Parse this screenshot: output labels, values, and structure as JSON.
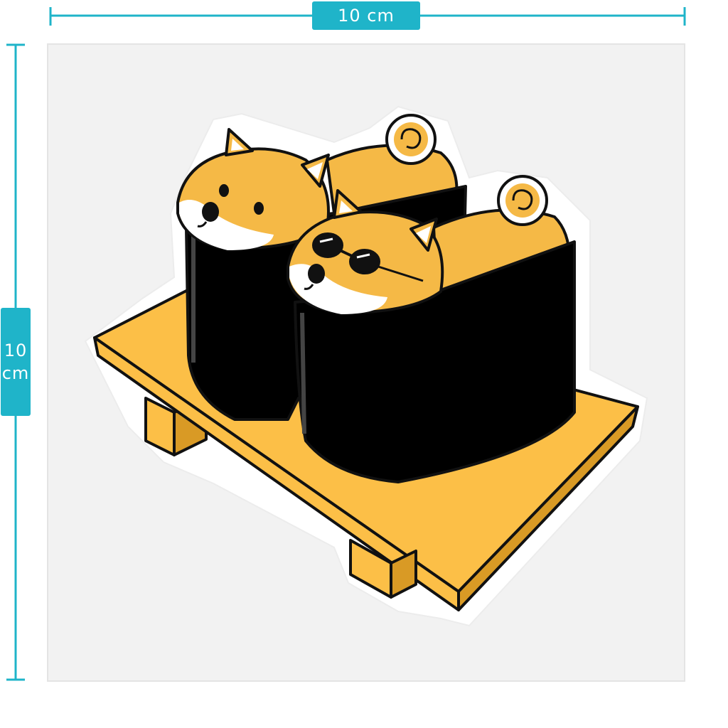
{
  "dimensions": {
    "width_value": "10",
    "width_unit": "cm",
    "height_value": "10",
    "height_unit": "cm"
  },
  "artwork": {
    "icons": [
      "shiba-inu-dog-icon",
      "shiba-with-sunglasses-icon",
      "nori-seaweed-wrap-icon",
      "sushi-geta-board-icon"
    ]
  },
  "colors": {
    "accent": "#1fb4c9",
    "sticker_bg": "#f2f2f2",
    "dog_fur": "#f5b946",
    "board": "#fcbf47",
    "nori": "#000000"
  }
}
